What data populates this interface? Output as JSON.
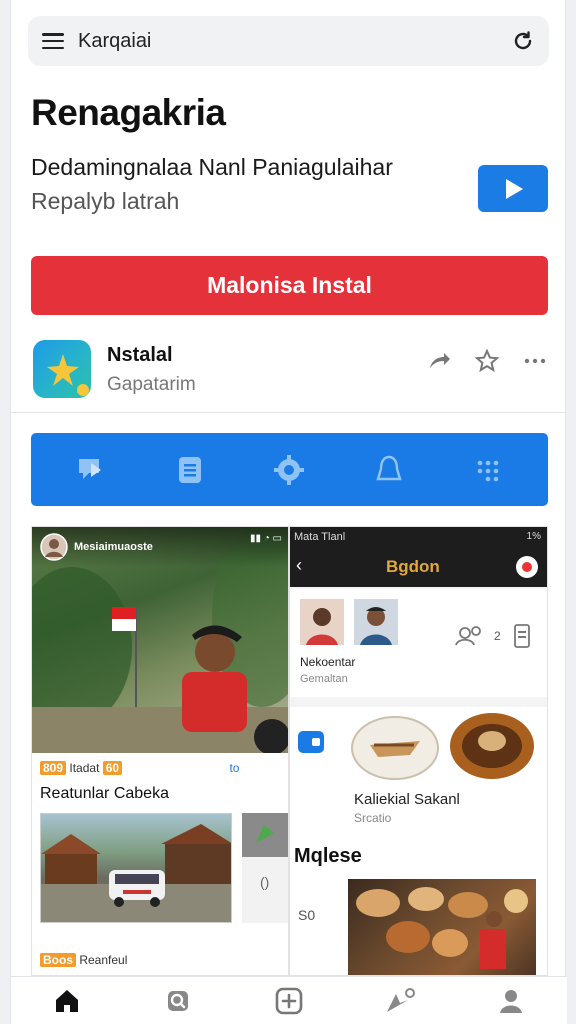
{
  "search": {
    "label": "Karqaiai"
  },
  "title": "Renagakria",
  "subtitle": "Dedamingnalaa Nanl Paniagulaihar",
  "subtitle2": "Repalyb latrah",
  "install_button": "Malonisa Instal",
  "app": {
    "name": "Nstalal",
    "developer": "Gapatarim"
  },
  "colors": {
    "accent_blue": "#1a7be6",
    "install_red": "#e5323a",
    "star": "#f5c53a"
  },
  "categories": [
    "chat-icon",
    "document-icon",
    "gear-icon",
    "bell-icon",
    "grid-dots-icon"
  ],
  "screenshot_left": {
    "header_title": "Mesiaimuaoste",
    "meta": "Itadat",
    "meta_tag": "809",
    "meta_count": "60",
    "meta_right": "to",
    "heading": "Reatunlar Cabeka",
    "footer_tag": "Boos",
    "footer_text": "Reanfeul"
  },
  "screenshot_right": {
    "status_left": "Mata Tlanl",
    "status_right": "1%",
    "header_title": "Bgdon",
    "profile_name": "Nekoentar",
    "profile_sub": "Gemaltan",
    "counter": "2",
    "dish_title": "Kaliekial Sakanl",
    "dish_sub": "Srcatio",
    "section_heading": "Mqlese",
    "side_label": "S0"
  },
  "nav": [
    "home-icon",
    "search-icon",
    "add-icon",
    "send-icon",
    "profile-icon"
  ]
}
